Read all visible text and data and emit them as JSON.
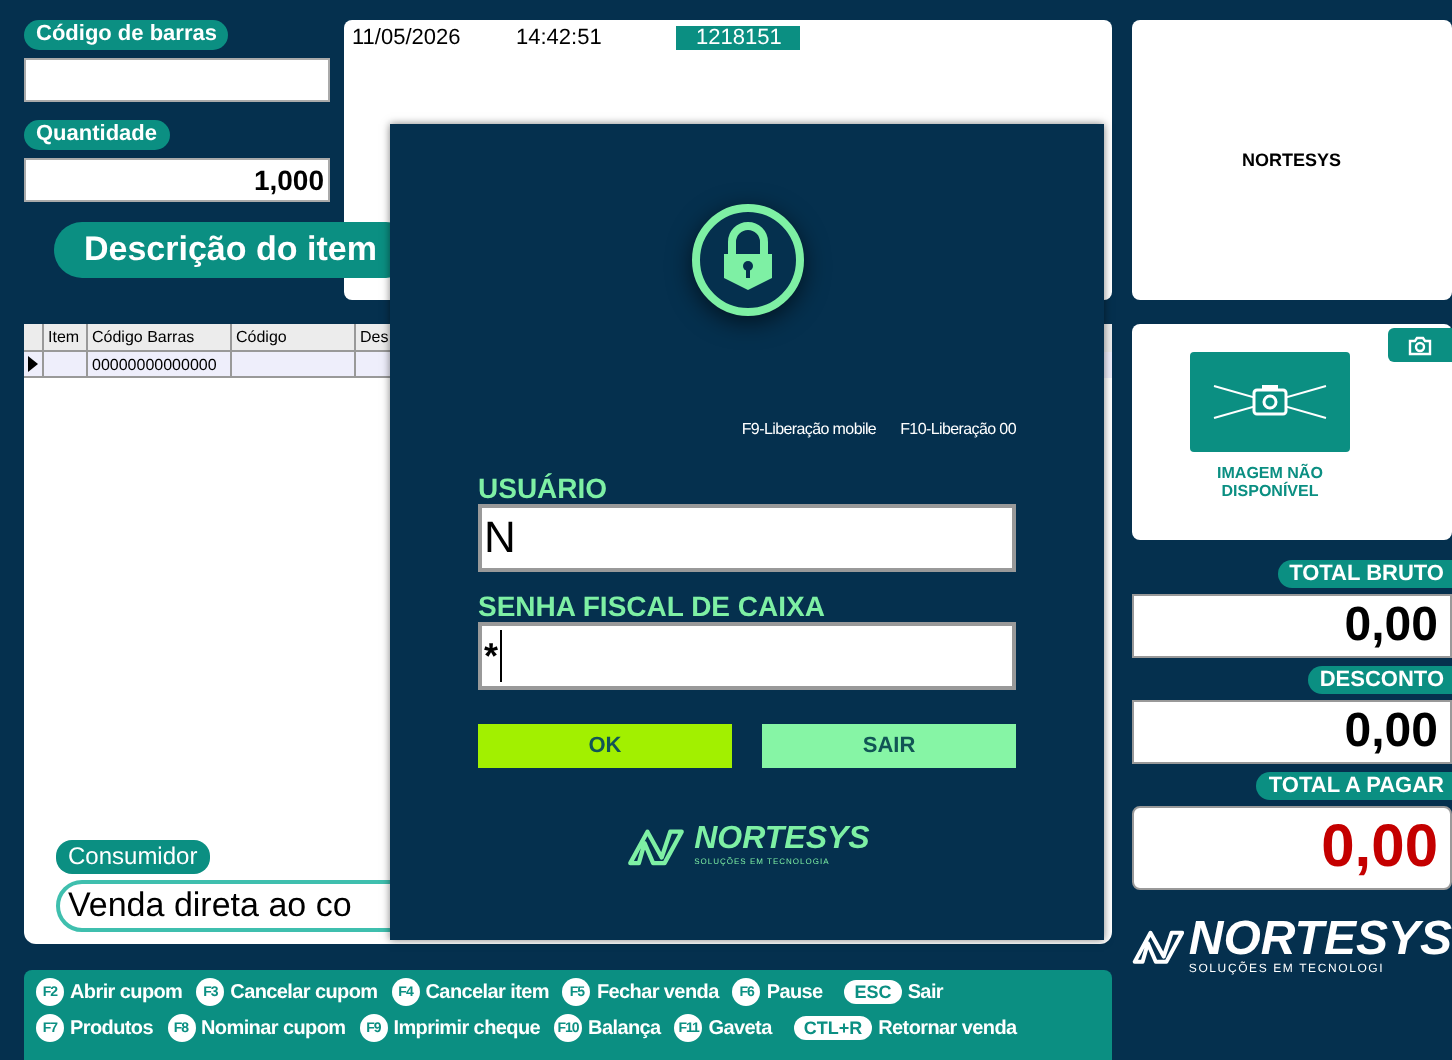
{
  "header": {
    "date": "11/05/2026",
    "time": "14:42:51",
    "code": "1218151"
  },
  "barcode": {
    "label": "Código de barras"
  },
  "quantity": {
    "label": "Quantidade",
    "value": "1,000"
  },
  "item_description_button": "Descrição do item",
  "table": {
    "columns": [
      "Item",
      "Código Barras",
      "Código",
      "Des"
    ],
    "rows": [
      {
        "barcode": "00000000000000",
        "selected": true
      }
    ]
  },
  "consumer": {
    "label": "Consumidor",
    "value": "Venda direta ao co"
  },
  "login_dialog": {
    "shortcuts": [
      "F9-Liberação mobile",
      "F10-Liberação 00"
    ],
    "user": {
      "label": "USUÁRIO",
      "value": "N"
    },
    "password": {
      "label": "SENHA FISCAL DE CAIXA",
      "value": "*"
    },
    "buttons": [
      {
        "label": "OK",
        "kind": "primary"
      },
      {
        "label": "SAIR",
        "kind": "secondary"
      }
    ],
    "logo": {
      "name": "NORTESYS",
      "tagline": "SOLUÇÕES EM TECNOLOGIA"
    }
  },
  "brand_panel": {
    "text": "NORTESYS"
  },
  "product_image": {
    "caption": "IMAGEM NÃO DISPONÍVEL"
  },
  "totals": [
    {
      "label": "TOTAL BRUTO",
      "value": "0,00",
      "kind": "normal"
    },
    {
      "label": "DESCONTO",
      "value": "0,00",
      "kind": "normal"
    },
    {
      "label": "TOTAL A PAGAR",
      "value": "0,00",
      "kind": "due"
    }
  ],
  "shortcut_bar": [
    [
      {
        "key": "F2",
        "label": "Abrir cupom",
        "kind": "fkey"
      },
      {
        "key": "F3",
        "label": "Cancelar cupom",
        "kind": "fkey"
      },
      {
        "key": "F4",
        "label": "Cancelar item",
        "kind": "fkey"
      },
      {
        "key": "F5",
        "label": "Fechar venda",
        "kind": "fkey"
      },
      {
        "key": "F6",
        "label": "Pause",
        "kind": "fkey"
      },
      {
        "key": "ESC",
        "label": "Sair",
        "kind": "combo"
      }
    ],
    [
      {
        "key": "F7",
        "label": "Produtos",
        "kind": "fkey"
      },
      {
        "key": "F8",
        "label": "Nominar cupom",
        "kind": "fkey"
      },
      {
        "key": "F9",
        "label": "Imprimir cheque",
        "kind": "fkey"
      },
      {
        "key": "F10",
        "label": "Balança",
        "kind": "fkey"
      },
      {
        "key": "F11",
        "label": "Gaveta",
        "kind": "fkey"
      },
      {
        "key": "CTL+R",
        "label": "Retornar venda",
        "kind": "combo"
      }
    ]
  ],
  "footer_logo": {
    "name": "NORTESYS",
    "tagline": "SOLUÇÕES EM TECNOLOGI"
  }
}
